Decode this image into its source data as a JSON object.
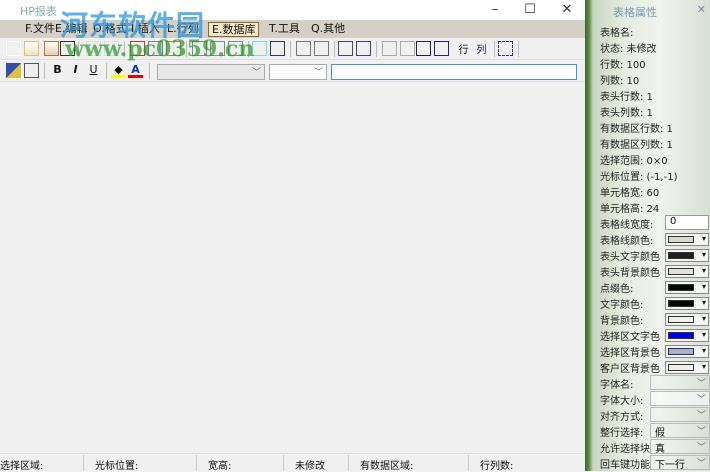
{
  "window": {
    "title": "HP报表",
    "minimize": "–",
    "maximize": "☐",
    "close": "✕"
  },
  "watermark": {
    "site_name": "河东软件园",
    "url": "www.pc0359.cn"
  },
  "menu": [
    "F.文件",
    "E.编辑",
    "O.格式",
    "I.插入",
    "L.行列",
    "E.数据库",
    "T.工具",
    "Q.其他"
  ],
  "menu_active": "E.数据库",
  "toolbar2": {
    "bold": "B",
    "italic": "I",
    "underline": "U",
    "font_name": "",
    "font_size": "",
    "cell_input": ""
  },
  "toolbar1_text": {
    "row": "行",
    "col": "列"
  },
  "status": [
    "选择区域:",
    "光标位置:",
    "宽高:",
    "未修改",
    "有数据区域:",
    "行列数:"
  ],
  "panel": {
    "title": "表格属性",
    "close": "✕",
    "info": [
      "表格名:",
      "状态: 未修改",
      "行数: 100",
      "列数: 10",
      "表头行数: 1",
      "表头列数: 1",
      "有数据区行数: 1",
      "有数据区列数: 1",
      "选择范围: 0×0",
      "光标位置: (-1,-1)",
      "单元格宽: 60",
      "单元格高: 24"
    ],
    "line_width": {
      "label": "表格线宽度:",
      "value": "0"
    },
    "colors": [
      {
        "label": "表格线颜色:",
        "color": "#d8d8d0"
      },
      {
        "label": "表头文字颜色",
        "color": "#202020"
      },
      {
        "label": "表头背景颜色",
        "color": "#e0e0dc"
      },
      {
        "label": "点缀色:",
        "color": "#000800"
      },
      {
        "label": "文字颜色:",
        "color": "#000800"
      },
      {
        "label": "背景颜色:",
        "color": "#f0f0ec"
      },
      {
        "label": "选择区文字色",
        "color": "#0000e0"
      },
      {
        "label": "选择区背景色",
        "color": "#a8b0d8"
      },
      {
        "label": "客户区背景色",
        "color": "#f0f0e8"
      }
    ],
    "fonts": [
      {
        "label": "字体名:",
        "value": ""
      },
      {
        "label": "字体大小:",
        "value": ""
      },
      {
        "label": "对齐方式:",
        "value": ""
      },
      {
        "label": "整行选择:",
        "value": "假"
      },
      {
        "label": "允许选择块",
        "value": "真"
      },
      {
        "label": "回车键功能",
        "value": "下一行"
      }
    ]
  }
}
